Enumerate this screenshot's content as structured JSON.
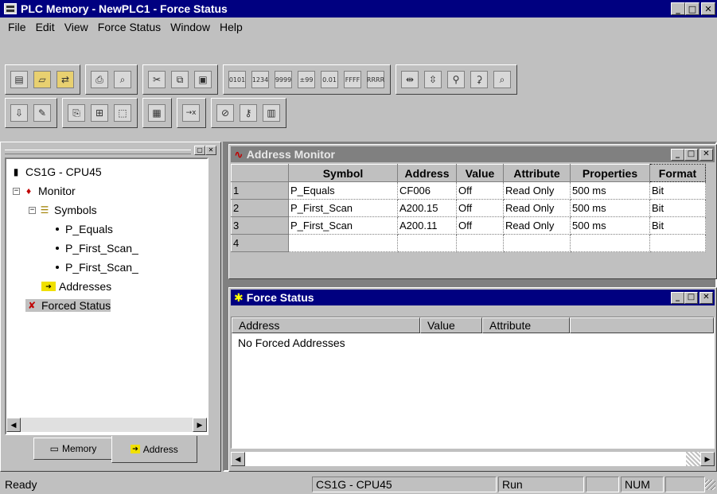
{
  "window": {
    "title": "PLC Memory - NewPLC1 - Force Status"
  },
  "menu": [
    "File",
    "Edit",
    "View",
    "Force Status",
    "Window",
    "Help"
  ],
  "tree": {
    "root": "CS1G - CPU45",
    "monitor": "Monitor",
    "symbols": "Symbols",
    "symbol_items": [
      "P_Equals",
      "P_First_Scan_",
      "P_First_Scan_"
    ],
    "addresses": "Addresses",
    "forced": "Forced Status"
  },
  "left_tabs": [
    "Memory",
    "Address"
  ],
  "address_monitor": {
    "title": "Address Monitor",
    "columns": [
      "Symbol",
      "Address",
      "Value",
      "Attribute",
      "Properties",
      "Format"
    ],
    "rows": [
      {
        "num": "1",
        "cells": [
          "P_Equals",
          "CF006",
          "Off",
          "Read Only",
          "500 ms",
          "Bit"
        ]
      },
      {
        "num": "2",
        "cells": [
          "P_First_Scan",
          "A200.15",
          "Off",
          "Read Only",
          "500 ms",
          "Bit"
        ]
      },
      {
        "num": "3",
        "cells": [
          "P_First_Scan",
          "A200.11",
          "Off",
          "Read Only",
          "500 ms",
          "Bit"
        ]
      },
      {
        "num": "4",
        "cells": [
          "",
          "",
          "",
          "",
          "",
          ""
        ]
      }
    ]
  },
  "force_status": {
    "title": "Force Status",
    "columns": [
      "Address",
      "Value",
      "Attribute"
    ],
    "empty_message": "No Forced Addresses"
  },
  "statusbar": {
    "ready": "Ready",
    "device": "CS1G - CPU45",
    "mode": "Run",
    "num": "NUM"
  },
  "colors": {
    "active_title": "#000080",
    "inactive_title": "#808080",
    "face": "#c0c0c0"
  }
}
